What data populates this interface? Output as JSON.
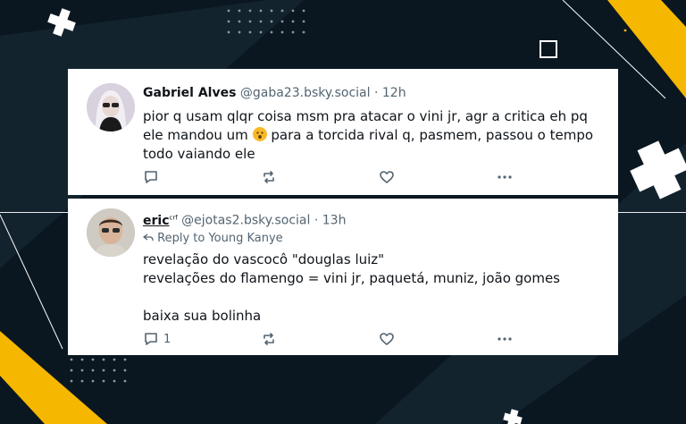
{
  "posts": [
    {
      "author_name": "Gabriel Alves",
      "handle": "@gaba23.bsky.social",
      "separator": "·",
      "time": "12h",
      "body_part1": "pior q usam qlqr coisa msm pra atacar o vini jr, agr a critica eh pq",
      "body_part2a": "ele mandou um",
      "body_part2b": "para a torcida rival q, pasmem, passou o tempo",
      "body_part3": "todo vaiando ele",
      "emoji": "hushed-face-emoji",
      "reply_count": "",
      "icons": [
        "reply-icon",
        "repost-icon",
        "like-icon",
        "more-icon"
      ]
    },
    {
      "author_name": "eric",
      "author_flair": "crf",
      "handle": "@ejotas2.bsky.social",
      "separator": "·",
      "time": "13h",
      "reply_to": "Reply to Young Kanye",
      "lines": [
        "revelação do vascocô \"douglas luiz\"",
        "revelações do flamengo = vini jr, paquetá, muniz, joão gomes",
        "",
        "baixa sua bolinha"
      ],
      "reply_count": "1",
      "icons": [
        "reply-icon",
        "repost-icon",
        "like-icon",
        "more-icon"
      ]
    }
  ],
  "colors": {
    "background": "#0b1720",
    "accent_yellow": "#f5b700",
    "card": "#ffffff",
    "muted_text": "#536471"
  }
}
